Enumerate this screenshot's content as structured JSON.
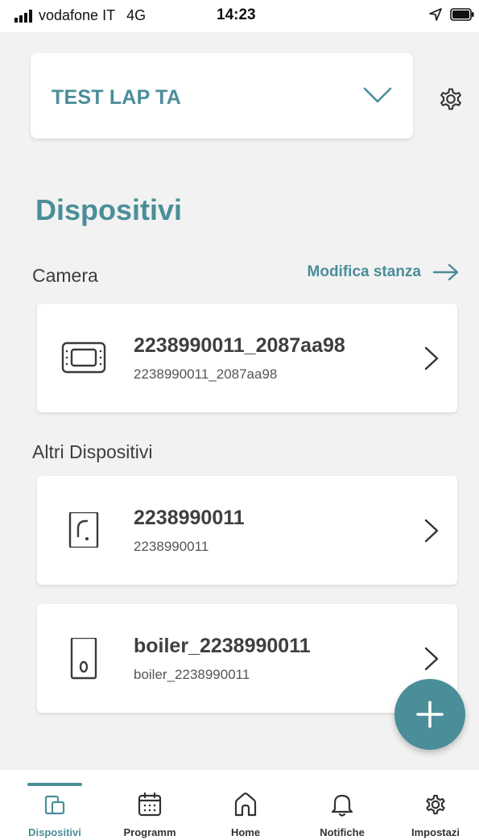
{
  "status_bar": {
    "carrier": "vodafone IT",
    "network": "4G",
    "time": "14:23"
  },
  "header": {
    "house_name": "TEST LAP TA",
    "icons": [
      "chevron-down-icon",
      "gear-icon"
    ]
  },
  "page_title": "Dispositivi",
  "rooms": [
    {
      "title": "Camera",
      "edit_label": "Modifica stanza",
      "devices": [
        {
          "name": "2238990011_2087aa98",
          "subtitle": "2238990011_2087aa98",
          "icon": "thermostat-icon"
        }
      ]
    },
    {
      "title": "Altri Dispositivi",
      "devices": [
        {
          "name": "2238990011",
          "subtitle": "2238990011",
          "icon": "gateway-icon"
        },
        {
          "name": "boiler_2238990011",
          "subtitle": "boiler_2238990011",
          "icon": "boiler-icon"
        }
      ]
    }
  ],
  "fab": {
    "icon": "plus-icon"
  },
  "bottom_nav": {
    "active": 0,
    "items": [
      {
        "label": "Dispositivi",
        "icon": "devices-icon"
      },
      {
        "label": "Programm",
        "icon": "calendar-icon"
      },
      {
        "label": "Home",
        "icon": "home-icon"
      },
      {
        "label": "Notifiche",
        "icon": "bell-icon"
      },
      {
        "label": "Impostazi",
        "icon": "settings-icon"
      }
    ]
  },
  "colors": {
    "accent": "#4a8e99",
    "background": "#f2f2f2",
    "card": "#ffffff",
    "text": "#3a3a3a"
  }
}
